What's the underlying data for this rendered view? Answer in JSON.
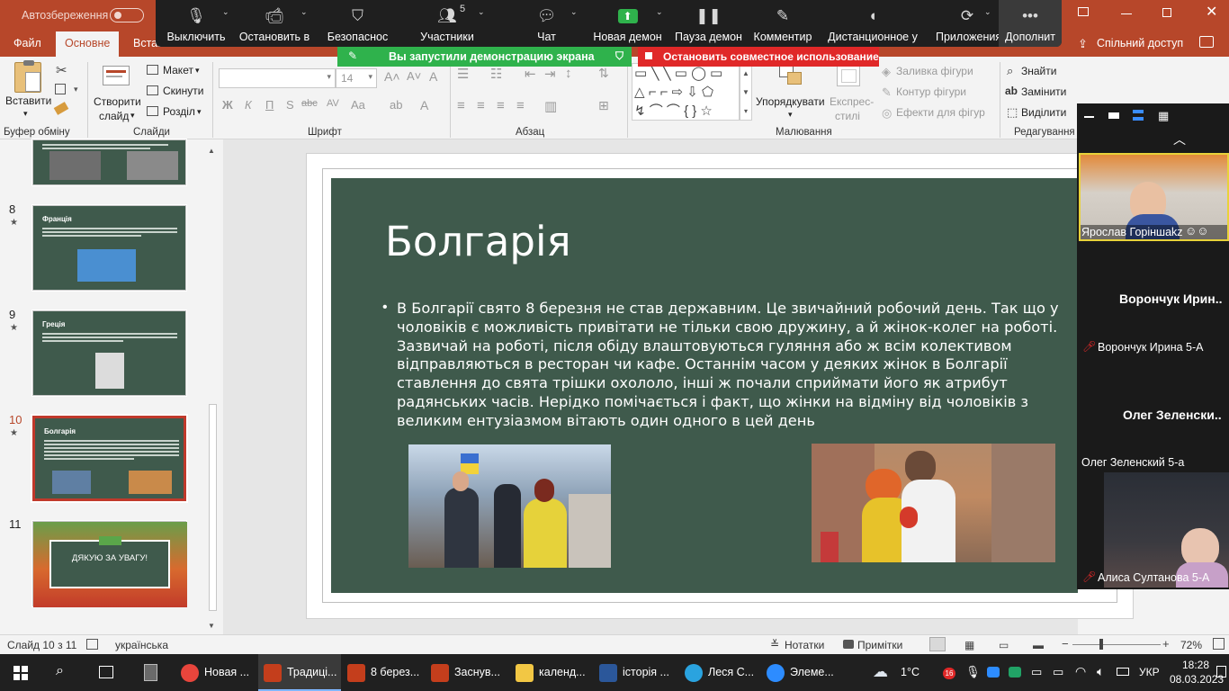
{
  "titlebar": {
    "autosave_label": "Автозбереження",
    "autosave_state": "Вимк.",
    "share_label": "Спільний доступ"
  },
  "ribbon_tabs": [
    "Файл",
    "Основне",
    "Вставл"
  ],
  "ribbon": {
    "paste": "Вставити",
    "clipboard_group": "Буфер обміну",
    "new_slide_1": "Створити",
    "new_slide_2": "слайд",
    "layout": "Макет",
    "reset": "Скинути",
    "section": "Розділ",
    "slides_group": "Слайди",
    "font_size": "14",
    "font_group": "Шрифт",
    "paragraph_group": "Абзац",
    "arrange": "Упорядкувати",
    "quick_styles_1": "Експрес-",
    "quick_styles_2": "стилі",
    "shape_fill": "Заливка фігури",
    "shape_outline": "Контур фігури",
    "shape_effects": "Ефекти для фігур",
    "drawing_group": "Малювання",
    "find": "Знайти",
    "replace": "Замінити",
    "select": "Виділити",
    "editing_group": "Редагування"
  },
  "zoom": {
    "items": [
      {
        "label": "Выключить",
        "icon": "microphone-icon"
      },
      {
        "label": "Остановить в",
        "icon": "video-camera-icon"
      },
      {
        "label": "Безопаснос",
        "icon": "shield-icon"
      },
      {
        "label": "Участники",
        "icon": "participants-icon",
        "count": "5"
      },
      {
        "label": "Чат",
        "icon": "chat-icon"
      },
      {
        "label": "Новая демон",
        "icon": "share-screen-icon"
      },
      {
        "label": "Пауза демон",
        "icon": "pause-icon"
      },
      {
        "label": "Комментир",
        "icon": "pencil-icon"
      },
      {
        "label": "Дистанционное у",
        "icon": "mouse-icon"
      },
      {
        "label": "Приложения",
        "icon": "apps-icon"
      },
      {
        "label": "Дополнит",
        "icon": "more-icon"
      }
    ],
    "share_banner": "Вы запустили демонстрацию экрана",
    "stop_banner": "Остановить совместное использование",
    "colors": {
      "green": "#2fb24c",
      "red": "#e02828",
      "bar": "#1f1f1f"
    }
  },
  "thumbnails": [
    {
      "num": "8",
      "title": "Франція"
    },
    {
      "num": "9",
      "title": "Греція"
    },
    {
      "num": "10",
      "title": "Болгарія"
    },
    {
      "num": "11",
      "title": "ДЯКУЮ ЗА УВАГУ!"
    }
  ],
  "slide": {
    "title": "Болгарія",
    "body": "В Болгарії свято 8 березня не став державним. Це звичайний робочий день. Так що у чоловіків є можливість привітати не тільки свою дружину, а й жінок-колег на роботі. Зазвичай на роботі, після обіду влаштовуються гуляння або ж всім колективом відправляються в ресторан чи кафе. Останнім часом у деяких жінок в Болгарії ставлення до свята трішки охололо, інші ж почали сприймати його як атрибут радянських часів. Нерідко помічається і факт, що жінки на відміну від чоловіків з великим ентузіазмом вітають один одного в цей день",
    "bg_color": "#3f5a4c"
  },
  "participants": [
    {
      "name": "Ярослав Горіншakz",
      "kind": "video"
    },
    {
      "name": "Ворончук Ирина 5-А",
      "big": "Ворончук  Ирин..",
      "muted": true
    },
    {
      "name": "Олег Зеленский 5-а",
      "big": "Олег  Зеленски..",
      "muted": false
    },
    {
      "name": "Алиса Султанова 5-А",
      "kind": "video",
      "muted": true
    }
  ],
  "status": {
    "slide_counter": "Слайд 10 з 11",
    "language": "українська",
    "notes": "Нотатки",
    "comments": "Примітки",
    "zoom_level": "72%"
  },
  "taskbar": {
    "items": [
      {
        "label": "Новая ...",
        "icon": "chrome-icon"
      },
      {
        "label": "Традиці...",
        "icon": "powerpoint-icon"
      },
      {
        "label": "8 берез...",
        "icon": "powerpoint-icon"
      },
      {
        "label": "Заснув...",
        "icon": "powerpoint-icon"
      },
      {
        "label": "календ...",
        "icon": "folder-icon"
      },
      {
        "label": "історія ...",
        "icon": "word-icon"
      },
      {
        "label": "Леся С...",
        "icon": "telegram-icon"
      },
      {
        "label": "Элеме...",
        "icon": "zoom-icon"
      }
    ],
    "weather": "1°C",
    "lang": "УКР",
    "time": "18:28",
    "date": "08.03.2023",
    "badge": "16"
  }
}
